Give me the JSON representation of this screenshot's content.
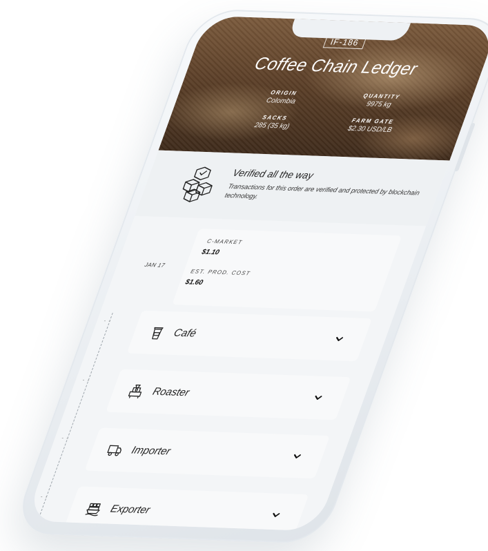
{
  "header": {
    "order_tag": "IF-186",
    "title": "Coffee Chain Ledger",
    "stats": [
      {
        "label": "ORIGIN",
        "value": "Colombia"
      },
      {
        "label": "QUANTITY",
        "value": "9975 kg"
      },
      {
        "label": "SACKS",
        "value": "285 (35 kg)"
      },
      {
        "label": "FARM GATE",
        "value": "$2.30 USD/LB"
      }
    ]
  },
  "verified": {
    "title": "Verified all the way",
    "text": "Transactions for this order are verified and protected by blockchain technology."
  },
  "prices": {
    "date": "JAN 17",
    "c_market_label": "C-MARKET",
    "c_market_value": "$1.10",
    "prod_cost_label": "EST. PROD. COST",
    "prod_cost_value": "$1.60"
  },
  "timeline_marker": "- -",
  "chain": [
    {
      "label": "Café",
      "icon": "coffee-cup-icon"
    },
    {
      "label": "Roaster",
      "icon": "roaster-machine-icon"
    },
    {
      "label": "Importer",
      "icon": "truck-icon"
    },
    {
      "label": "Exporter",
      "icon": "ship-icon"
    }
  ],
  "colors": {
    "hero_brown": "#5a3e27",
    "card_bg": "#f8f9fa",
    "screen_bg": "#f3f5f7",
    "text_dark": "#222222"
  }
}
